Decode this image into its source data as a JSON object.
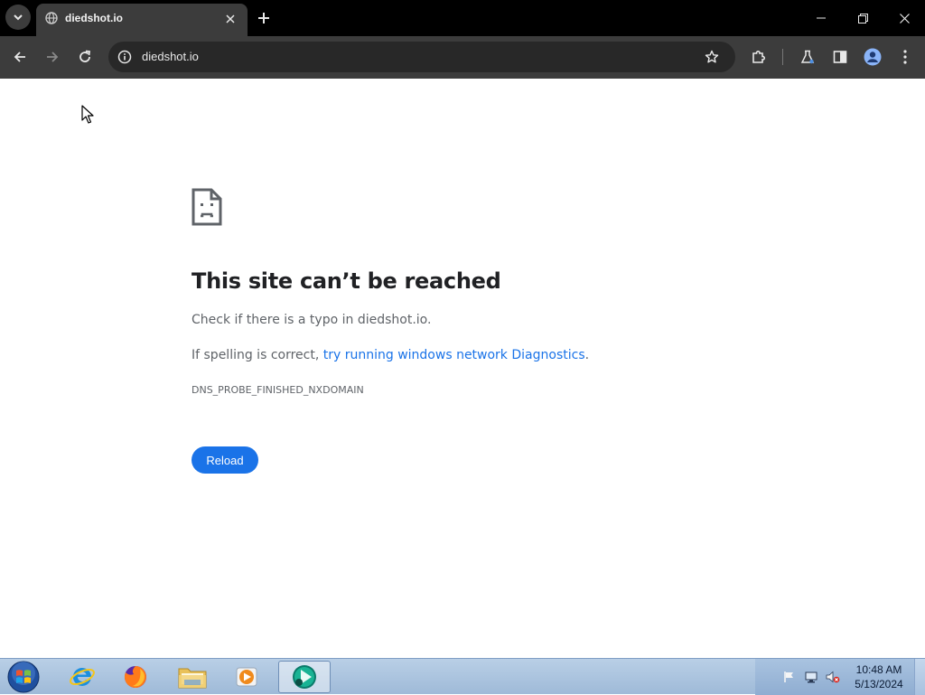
{
  "browser": {
    "tab": {
      "title": "diedshot.io"
    },
    "address_bar": {
      "url": "diedshot.io"
    }
  },
  "error_page": {
    "title": "This site can’t be reached",
    "line1": "Check if there is a typo in diedshot.io.",
    "line2_prefix": "If spelling is correct, ",
    "line2_link": "try running windows network Diagnostics",
    "line2_suffix": ".",
    "error_code": "DNS_PROBE_FINISHED_NXDOMAIN",
    "reload_label": "Reload"
  },
  "taskbar": {
    "apps": [
      "internet-explorer-icon",
      "firefox-icon",
      "file-explorer-icon",
      "media-player-icon",
      "browser-app-icon"
    ],
    "clock": {
      "time": "10:48 AM",
      "date": "5/13/2024"
    }
  },
  "colors": {
    "accent": "#1a73e8",
    "chrome_dark": "#3c3c3c",
    "titlebar": "#000000"
  }
}
